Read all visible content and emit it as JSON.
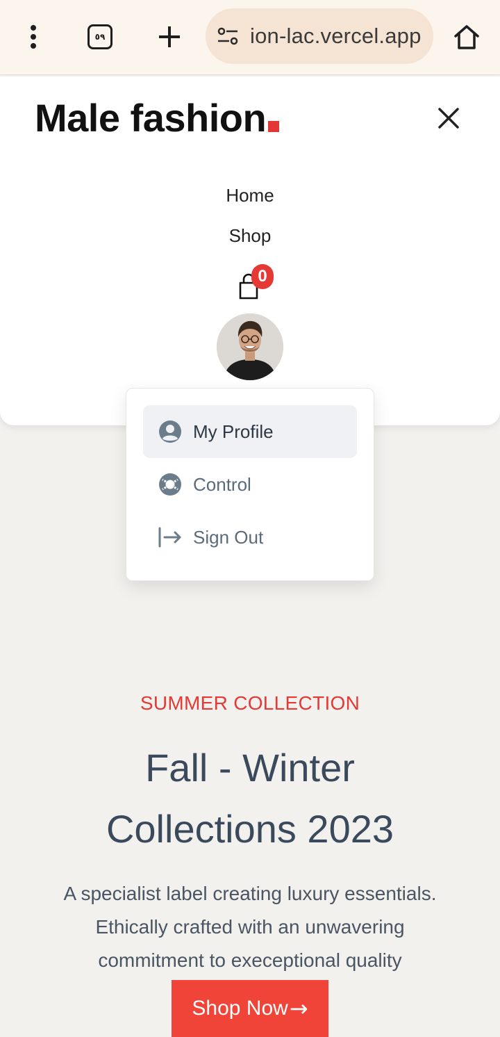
{
  "browser": {
    "tab_count": "٥٩",
    "url": "ion-lac.vercel.app",
    "icons": {
      "menu": "more-vertical-icon",
      "tabs": "tabs-icon",
      "new_tab": "plus-icon",
      "site_info": "site-settings-icon",
      "home": "home-icon"
    }
  },
  "header": {
    "logo_text": "Male fashion",
    "brand_color": "#e53637",
    "nav": [
      {
        "label": "Home"
      },
      {
        "label": "Shop"
      }
    ],
    "cart_count": "0",
    "close_icon": "close-icon"
  },
  "dropdown": {
    "items": [
      {
        "label": "My Profile",
        "icon": "user-circle-icon",
        "active": true
      },
      {
        "label": "Control",
        "icon": "lifebuoy-icon",
        "active": false
      },
      {
        "label": "Sign Out",
        "icon": "sign-out-icon",
        "active": false
      }
    ]
  },
  "hero": {
    "subtitle": "SUMMER COLLECTION",
    "title_line1": "Fall - Winter",
    "title_line2": "Collections 2023",
    "desc_line1": "A specialist label creating luxury essentials.",
    "desc_line2": "Ethically crafted with an unwavering",
    "desc_line3": "commitment to execeptional quality",
    "cta_label": "Shop Now",
    "cta_arrow": "→",
    "accent_color": "#e53935"
  }
}
